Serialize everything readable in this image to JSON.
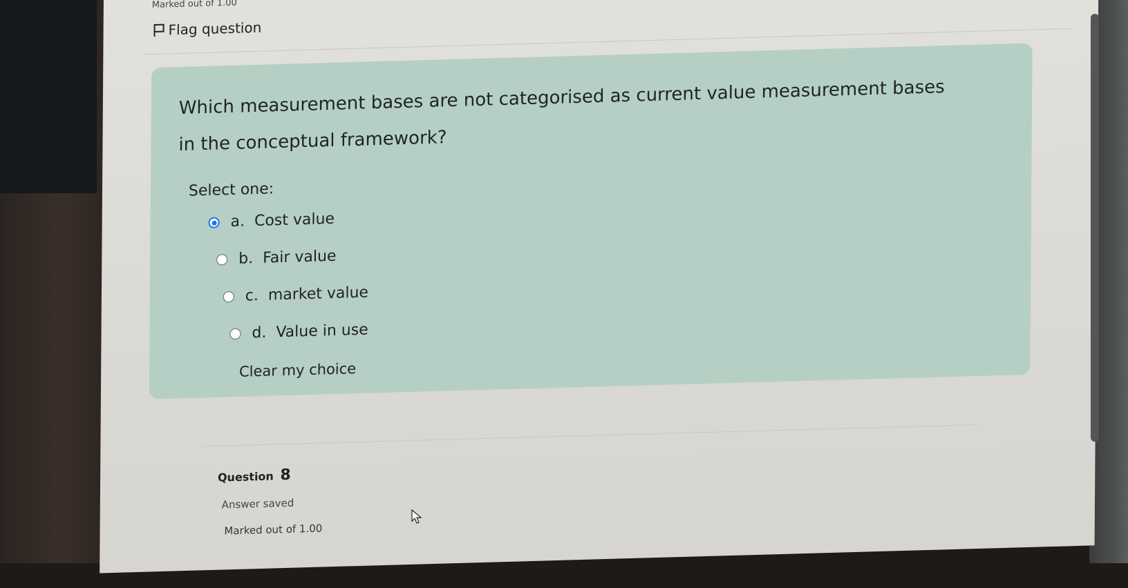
{
  "header": {
    "marked_out": "Marked out of 1.00",
    "flag_label": "Flag question"
  },
  "question": {
    "text_line1": "Which measurement bases are not categorised as current value measurement bases",
    "text_line2": "in the conceptual framework?",
    "select_label": "Select one:",
    "options": [
      {
        "letter": "a.",
        "label": "Cost value",
        "selected": true
      },
      {
        "letter": "b.",
        "label": "Fair value",
        "selected": false
      },
      {
        "letter": "c.",
        "label": "market value",
        "selected": false
      },
      {
        "letter": "d.",
        "label": "Value in use",
        "selected": false
      }
    ],
    "clear_label": "Clear my choice"
  },
  "next_question": {
    "label": "Question",
    "number": "8",
    "status": "Answer saved",
    "marked": "Marked out of 1.00"
  },
  "colors": {
    "question_bg": "#b5cfc4",
    "radio_selected": "#1a73e8"
  },
  "icons": {
    "flag": "flag-icon",
    "cursor": "mouse-pointer-icon"
  }
}
